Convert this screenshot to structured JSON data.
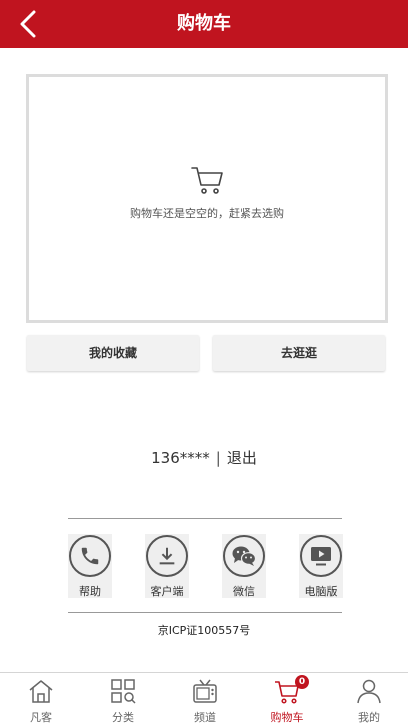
{
  "header": {
    "title": "购物车"
  },
  "cart": {
    "empty_text": "购物车还是空空的，赶紧去选购"
  },
  "actions": {
    "favorites_label": "我的收藏",
    "shop_label": "去逛逛"
  },
  "account": {
    "user": "136****",
    "separator": "|",
    "logout_label": "退出"
  },
  "footer": {
    "links": [
      {
        "label": "帮助",
        "icon": "phone-icon"
      },
      {
        "label": "客户端",
        "icon": "download-icon"
      },
      {
        "label": "微信",
        "icon": "wechat-icon"
      },
      {
        "label": "电脑版",
        "icon": "monitor-icon"
      }
    ],
    "icp": "京ICP证100557号"
  },
  "tabbar": {
    "active": "购物车",
    "items": [
      {
        "label": "凡客",
        "icon": "home-icon"
      },
      {
        "label": "分类",
        "icon": "grid-icon"
      },
      {
        "label": "频道",
        "icon": "tv-icon"
      },
      {
        "label": "购物车",
        "icon": "cart-icon",
        "badge": "0"
      },
      {
        "label": "我的",
        "icon": "user-icon"
      }
    ]
  },
  "colors": {
    "brand": "#c0141f",
    "border": "#dcdcdc",
    "button_bg": "#f2f2f2"
  }
}
